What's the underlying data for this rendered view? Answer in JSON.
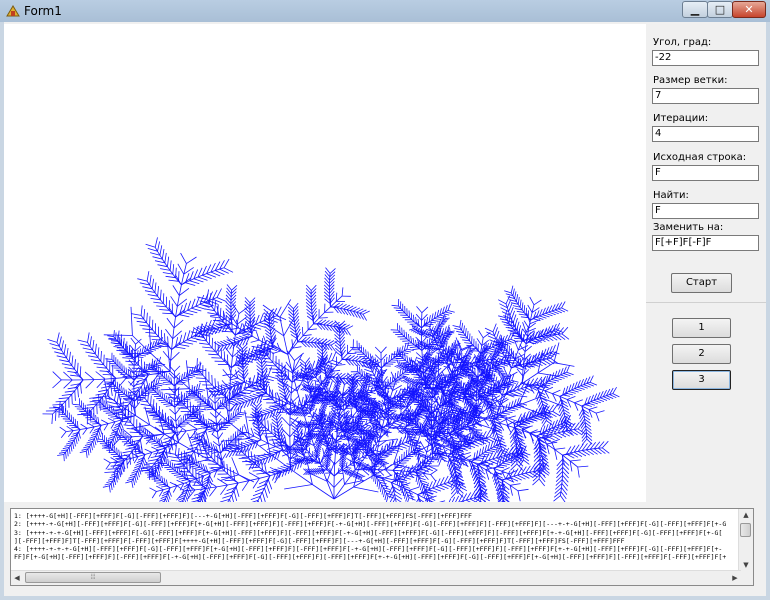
{
  "window": {
    "title": "Form1",
    "minimize_glyph": "▁",
    "maximize_glyph": "□",
    "close_glyph": "✕",
    "app_icon": "form-app-icon"
  },
  "settings": {
    "angle": {
      "label": "Угол, град:",
      "value": "-22"
    },
    "branch_size": {
      "label": "Размер ветки:",
      "value": "7"
    },
    "iterations": {
      "label": "Итерации:",
      "value": "4"
    },
    "axiom": {
      "label": "Исходная строка:",
      "value": "F"
    },
    "find": {
      "label": "Найти:",
      "value": "F"
    },
    "replace": {
      "label": "Заменить на:",
      "value": "F[+F]F[-F]F"
    },
    "start_button": "Старт"
  },
  "presets": [
    "1",
    "2",
    "3"
  ],
  "memo": {
    "lines": [
      "1: [++++-G[+H][-FFF][+FFF]F[-G][-FFF][+FFF]F][---+-G[+H][-FFF][+FFF]F[-G][-FFF][+FFF]F]T[-FFF][+FFF]FS[-FFF][+FFF]FFF",
      "2: [++++-+-G[+H][-FFF][+FFF]F[-G][-FFF][+FFF]F[+-G[+H][-FFF][+FFF]F][-FFF][+FFF]F[-+-G[+H][-FFF][+FFF]F[-G][-FFF][+FFF]F][-FFF][+FFF]F][---+-+-G[+H][-FFF][+FFF]F[-G][-FFF][+FFF]F[+-G",
      "3: [++++-+-+-G[+H][-FFF][+FFF]F[-G][-FFF][+FFF]F[+-G[+H][-FFF][+FFF]F][-FFF][+FFF]F[-+-G[+H][-FFF][+FFF]F[-G][-FFF][+FFF]F][-FFF][+FFF]F[+-+-G[+H][-FFF][+FFF]F[-G][-FFF][+FFF]F[+-G[",
      "][-FFF][+FFF]F]T[-FFF][+FFF]F[-FFF][+FFF]F[++++-G[+H][-FFF][+FFF]F[-G][-FFF][+FFF]F][---+-G[+H][-FFF][+FFF]F[-G][-FFF][+FFF]F]T[-FFF][+FFF]FS[-FFF][+FFF]FFF",
      "4: [++++-+-+-+-G[+H][-FFF][+FFF]F[-G][-FFF][+FFF]F[+-G[+H][-FFF][+FFF]F][-FFF][+FFF]F[-+-G[+H][-FFF][+FFF]F[-G][-FFF][+FFF]F][-FFF][+FFF]F[+-+-G[+H][-FFF][+FFF]F[-G][-FFF][+FFF]F[+-",
      "FF]F[+-G[+H][-FFF][+FFF]F][-FFF][+FFF]F[-+-G[+H][-FFF][+FFF]F[-G][-FFF][+FFF]F][-FFF][+FFF]F[+-+-G[+H][-FFF][+FFF]F[-G][-FFF][+FFF]F[+-G[+H][-FFF][+FFF]F][-FFF][+FFF]F[-FFF][+FFF]F[+"
    ]
  },
  "colors": {
    "fractal": "#1414ff"
  }
}
